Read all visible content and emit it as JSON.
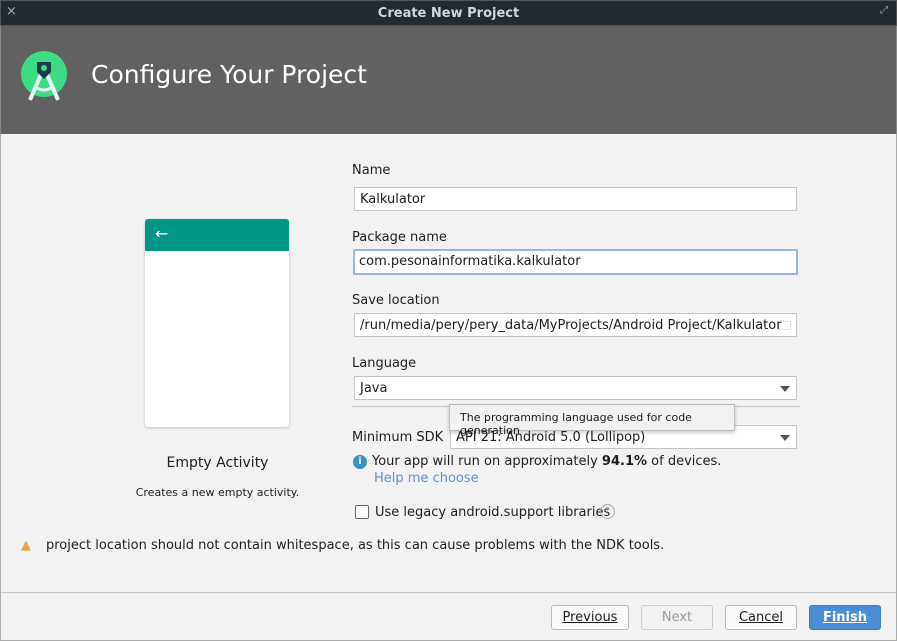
{
  "window": {
    "title": "Create New Project"
  },
  "header": {
    "title": "Configure Your Project"
  },
  "preview": {
    "template_name": "Empty Activity",
    "description": "Creates a new empty activity.",
    "accent": "#009688"
  },
  "form": {
    "name_label": "Name",
    "name_value": "Kalkulator",
    "package_label": "Package name",
    "package_value": "com.pesonainformatika.kalkulator",
    "save_label": "Save location",
    "save_value": "/run/media/pery/pery_data/MyProjects/Android Project/Kalkulator",
    "language_label": "Language",
    "language_value": "Java",
    "tooltip": "The programming language used for code generation",
    "sdk_label": "Minimum SDK",
    "sdk_value": "API 21: Android 5.0 (Lollipop)",
    "info_prefix": "Your app will run on approximately ",
    "info_percent": "94.1%",
    "info_suffix": " of devices.",
    "help_link": "Help me choose",
    "legacy_label": "Use legacy android.support libraries",
    "legacy_checked": false
  },
  "warning": "project location should not contain whitespace, as this can cause problems with the NDK tools.",
  "buttons": {
    "previous": "Previous",
    "next": "Next",
    "cancel": "Cancel",
    "finish": "Finish"
  }
}
